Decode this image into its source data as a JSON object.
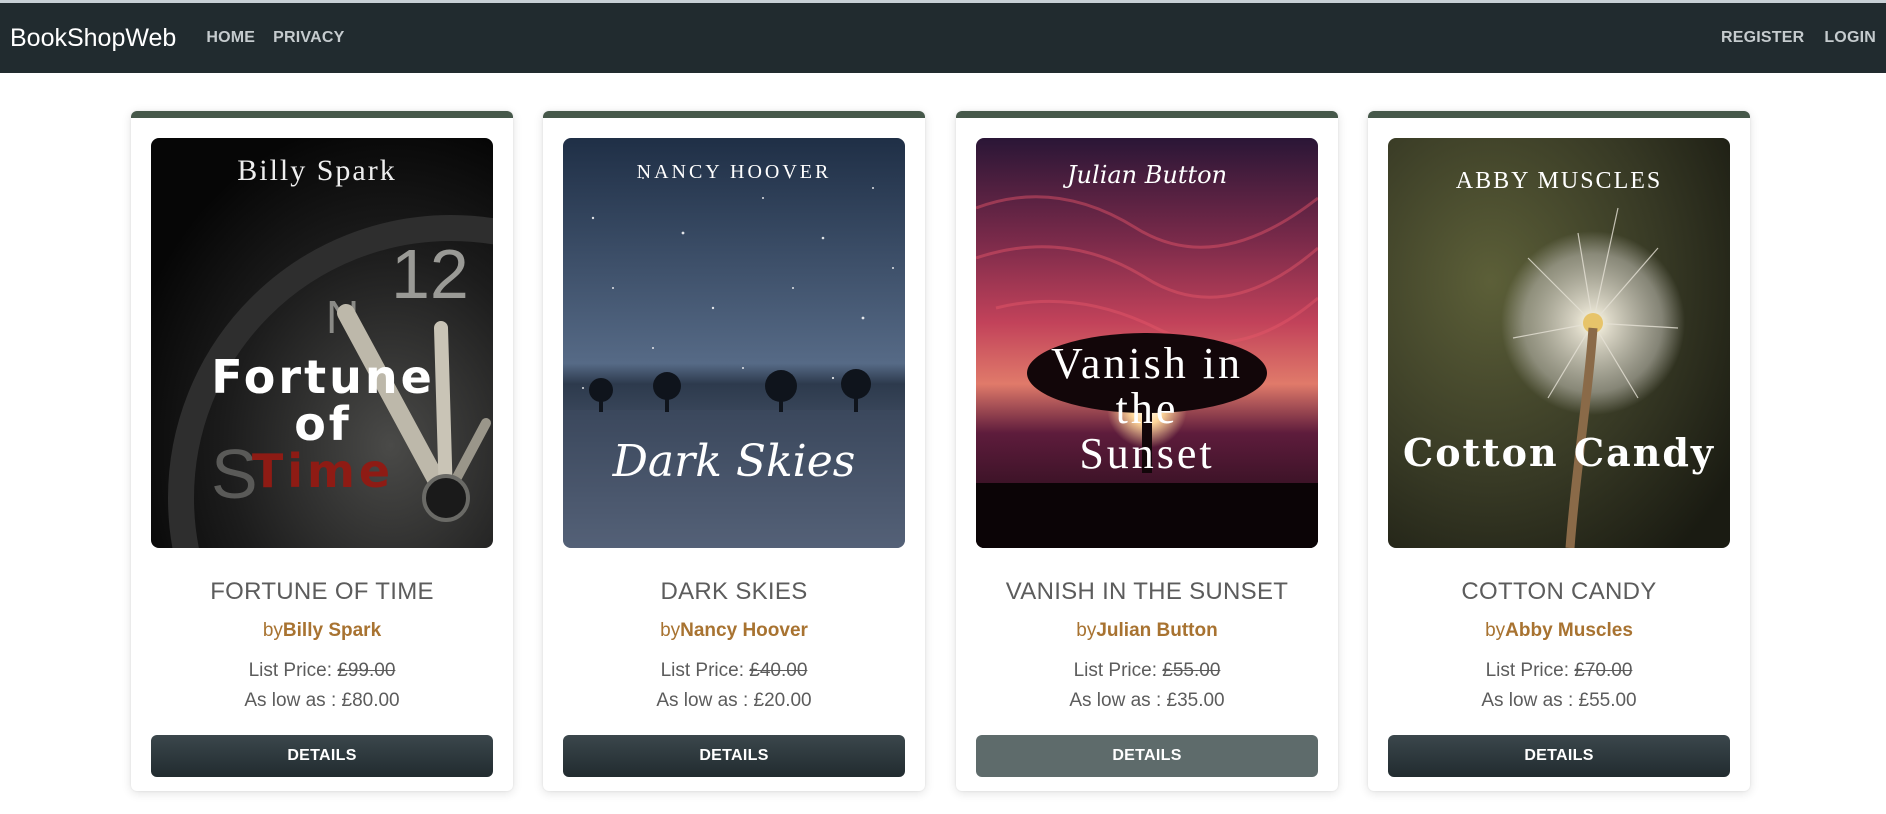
{
  "navbar": {
    "brand": "BookShopWeb",
    "links": [
      "HOME",
      "PRIVACY"
    ],
    "right_links": [
      "REGISTER",
      "LOGIN"
    ]
  },
  "products": [
    {
      "cover": {
        "author": "Billy Spark",
        "title_lines": [
          "Fortune",
          "of",
          "Time"
        ]
      },
      "title": "FORTUNE OF TIME",
      "by_prefix": "by",
      "author": "Billy Spark",
      "list_price_label": "List Price: ",
      "list_price": "£99.00",
      "low_price_text": "As low as : £80.00",
      "button": "DETAILS"
    },
    {
      "cover": {
        "author": "NANCY HOOVER",
        "title_lines": [
          "Dark Skies"
        ]
      },
      "title": "DARK SKIES",
      "by_prefix": "by",
      "author": "Nancy Hoover",
      "list_price_label": "List Price: ",
      "list_price": "£40.00",
      "low_price_text": "As low as : £20.00",
      "button": "DETAILS"
    },
    {
      "cover": {
        "author": "Julian Button",
        "title_lines": [
          "Vanish in",
          "the",
          "Sunset"
        ]
      },
      "title": "VANISH IN THE SUNSET",
      "by_prefix": "by",
      "author": "Julian Button",
      "list_price_label": "List Price: ",
      "list_price": "£55.00",
      "low_price_text": "As low as : £35.00",
      "button": "DETAILS"
    },
    {
      "cover": {
        "author": "ABBY MUSCLES",
        "title_lines": [
          "Cotton Candy"
        ]
      },
      "title": "COTTON CANDY",
      "by_prefix": "by",
      "author": "Abby Muscles",
      "list_price_label": "List Price: ",
      "list_price": "£70.00",
      "low_price_text": "As low as : £55.00",
      "button": "DETAILS"
    }
  ],
  "colors": {
    "navbar": "#212b2f",
    "card_accent": "#46584a",
    "author": "#a87331",
    "button": "#212b2f",
    "button_hover": "#5e6b6b"
  }
}
